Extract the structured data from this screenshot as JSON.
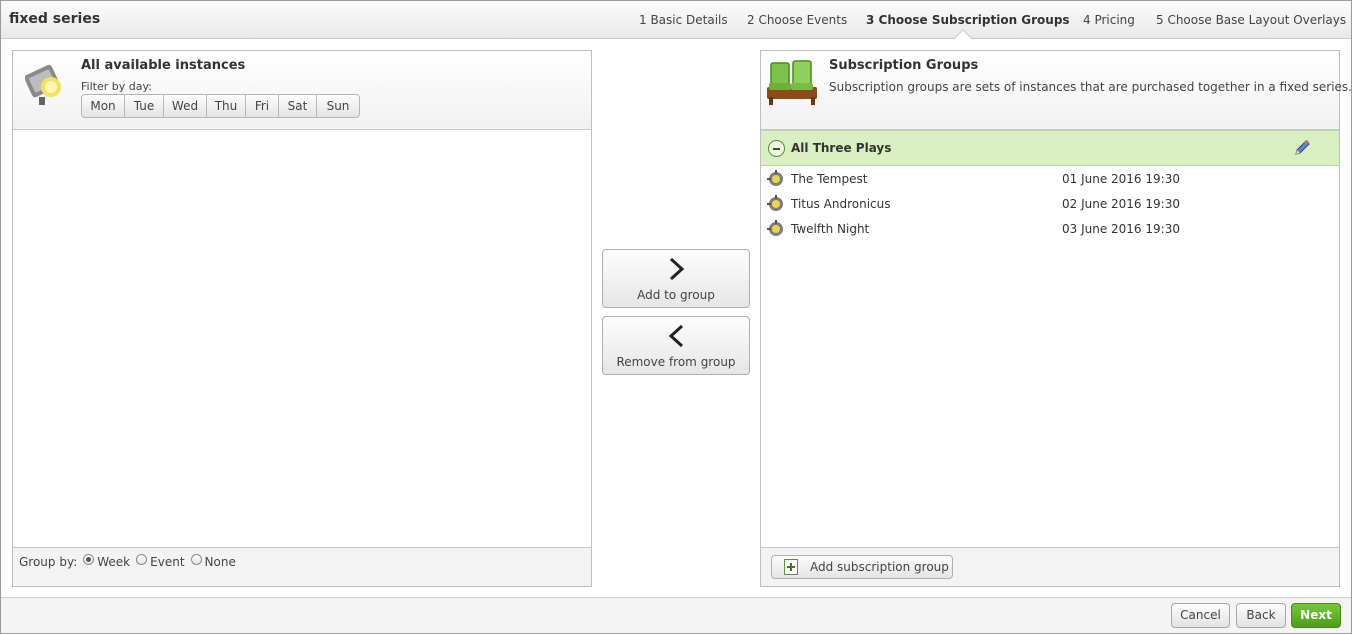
{
  "window": {
    "title": "fixed series"
  },
  "steps": [
    {
      "label": "1 Basic Details",
      "active": false
    },
    {
      "label": "2 Choose Events",
      "active": false
    },
    {
      "label": "3 Choose Subscription Groups",
      "active": true
    },
    {
      "label": "4 Pricing",
      "active": false
    },
    {
      "label": "5 Choose Base Layout Overlays",
      "active": false
    }
  ],
  "available": {
    "title": "All available instances",
    "filter_label": "Filter by day:",
    "days": [
      "Mon",
      "Tue",
      "Wed",
      "Thu",
      "Fri",
      "Sat",
      "Sun"
    ],
    "group_by_label": "Group by:",
    "group_by_options": [
      {
        "label": "Week",
        "checked": true
      },
      {
        "label": "Event",
        "checked": false
      },
      {
        "label": "None",
        "checked": false
      }
    ]
  },
  "actions": {
    "add_label": "Add to group",
    "remove_label": "Remove from group"
  },
  "subscription": {
    "title": "Subscription Groups",
    "description": "Subscription groups are sets of instances that are purchased together in a fixed series.",
    "group": {
      "name": "All Three Plays",
      "items": [
        {
          "name": "The Tempest",
          "date": "01 June 2016 19:30"
        },
        {
          "name": "Titus Andronicus",
          "date": "02 June 2016 19:30"
        },
        {
          "name": "Twelfth Night",
          "date": "03 June 2016 19:30"
        }
      ]
    },
    "add_group_label": "Add subscription group"
  },
  "footer": {
    "cancel_label": "Cancel",
    "back_label": "Back",
    "next_label": "Next"
  },
  "colors": {
    "group_bar": "#d8efc2",
    "next_button": "#5fb12a"
  },
  "icons": {
    "instances": "spotlight-icon",
    "subscription": "theatre-seats-icon",
    "row": "gear-spotlight-icon",
    "edit": "pencil-icon",
    "collapse": "minus-circle-icon",
    "add": "add-document-icon"
  }
}
